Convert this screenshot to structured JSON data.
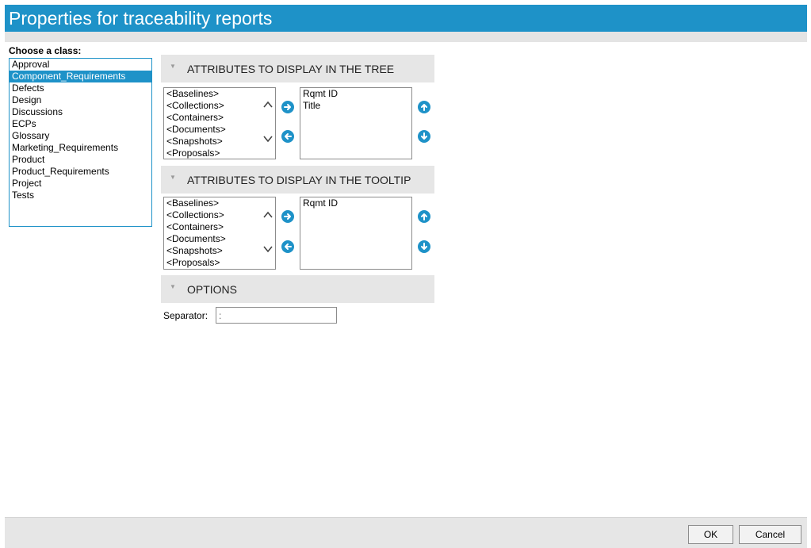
{
  "window": {
    "title": "Properties for traceability reports"
  },
  "class_chooser": {
    "label": "Choose a class:",
    "selected": "Component_Requirements",
    "items": [
      "Approval",
      "Component_Requirements",
      "Defects",
      "Design",
      "Discussions",
      "ECPs",
      "Glossary",
      "Marketing_Requirements",
      "Product",
      "Product_Requirements",
      "Project",
      "Tests"
    ]
  },
  "tree_section": {
    "title": "ATTRIBUTES TO DISPLAY IN THE TREE",
    "available": [
      "<Baselines>",
      "<Collections>",
      "<Containers>",
      "<Documents>",
      "<Snapshots>",
      "<Proposals>"
    ],
    "selected": [
      "Rqmt ID",
      "Title"
    ]
  },
  "tooltip_section": {
    "title": "ATTRIBUTES TO DISPLAY IN THE TOOLTIP",
    "available": [
      "<Baselines>",
      "<Collections>",
      "<Containers>",
      "<Documents>",
      "<Snapshots>",
      "<Proposals>"
    ],
    "selected": [
      "Rqmt ID"
    ]
  },
  "options_section": {
    "title": "OPTIONS",
    "separator_label": "Separator:",
    "separator_value": ":"
  },
  "footer": {
    "ok_label": "OK",
    "cancel_label": "Cancel"
  },
  "colors": {
    "accent": "#1e92c8",
    "panel_bg": "#e6e6e6"
  }
}
